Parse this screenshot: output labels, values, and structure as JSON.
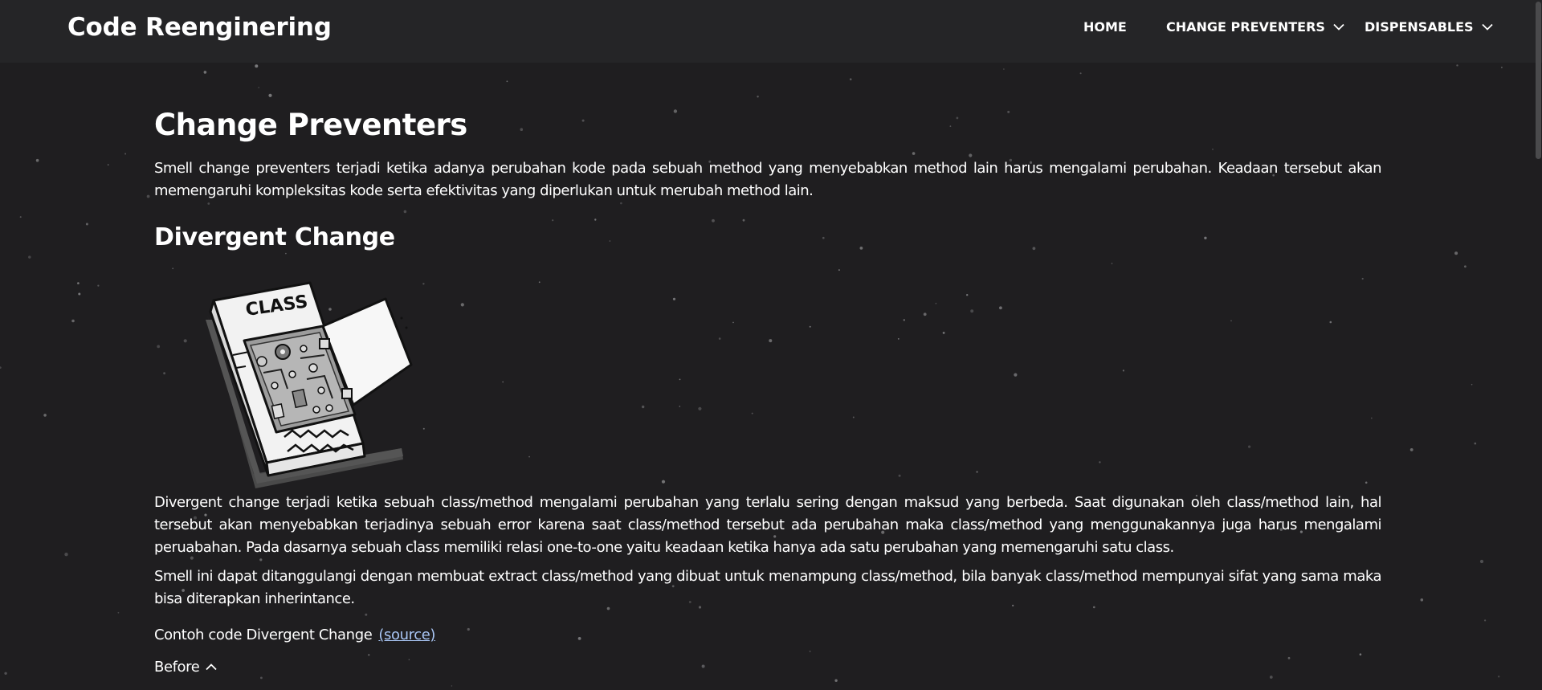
{
  "colors": {
    "background": "#1f1e20",
    "navbar": "#252527",
    "text": "#ffffff",
    "link": "#a9c6f5"
  },
  "navbar": {
    "brand": "Code Reenginering",
    "items": [
      {
        "label": "HOME",
        "icon": null
      },
      {
        "label": "CHANGE PREVENTERS",
        "icon": "chevron-down-icon"
      },
      {
        "label": "DISPENSABLES",
        "icon": "chevron-down-icon"
      }
    ]
  },
  "main": {
    "title": "Change Preventers",
    "intro": "Smell change preventers terjadi ketika adanya perubahan kode pada sebuah method yang menyebabkan method lain harus mengalami perubahan. Keadaan tersebut akan memengaruhi kompleksitas kode serta efektivitas yang diperlukan untuk merubah method lain.",
    "section": {
      "heading": "Divergent Change",
      "illustration_label": "CLASS",
      "paragraphs": [
        "Divergent change terjadi ketika sebuah class/method mengalami perubahan yang terlalu sering dengan maksud yang berbeda. Saat digunakan oleh class/method lain, hal tersebut akan menyebabkan terjadinya sebuah error karena saat class/method tersebut ada perubahan maka class/method yang menggunakannya juga harus mengalami peruabahan. Pada dasarnya sebuah class memiliki relasi one-to-one yaitu keadaan ketika hanya ada satu perubahan yang memengaruhi satu class.",
        "Smell ini dapat ditanggulangi dengan membuat extract class/method yang dibuat untuk menampung class/method, bila banyak class/method mempunyai sifat yang sama maka bisa diterapkan inherintance."
      ],
      "example_text": "Contoh code Divergent Change",
      "example_link": "(source)",
      "before_label": "Before",
      "before_icon": "chevron-up-icon"
    }
  }
}
